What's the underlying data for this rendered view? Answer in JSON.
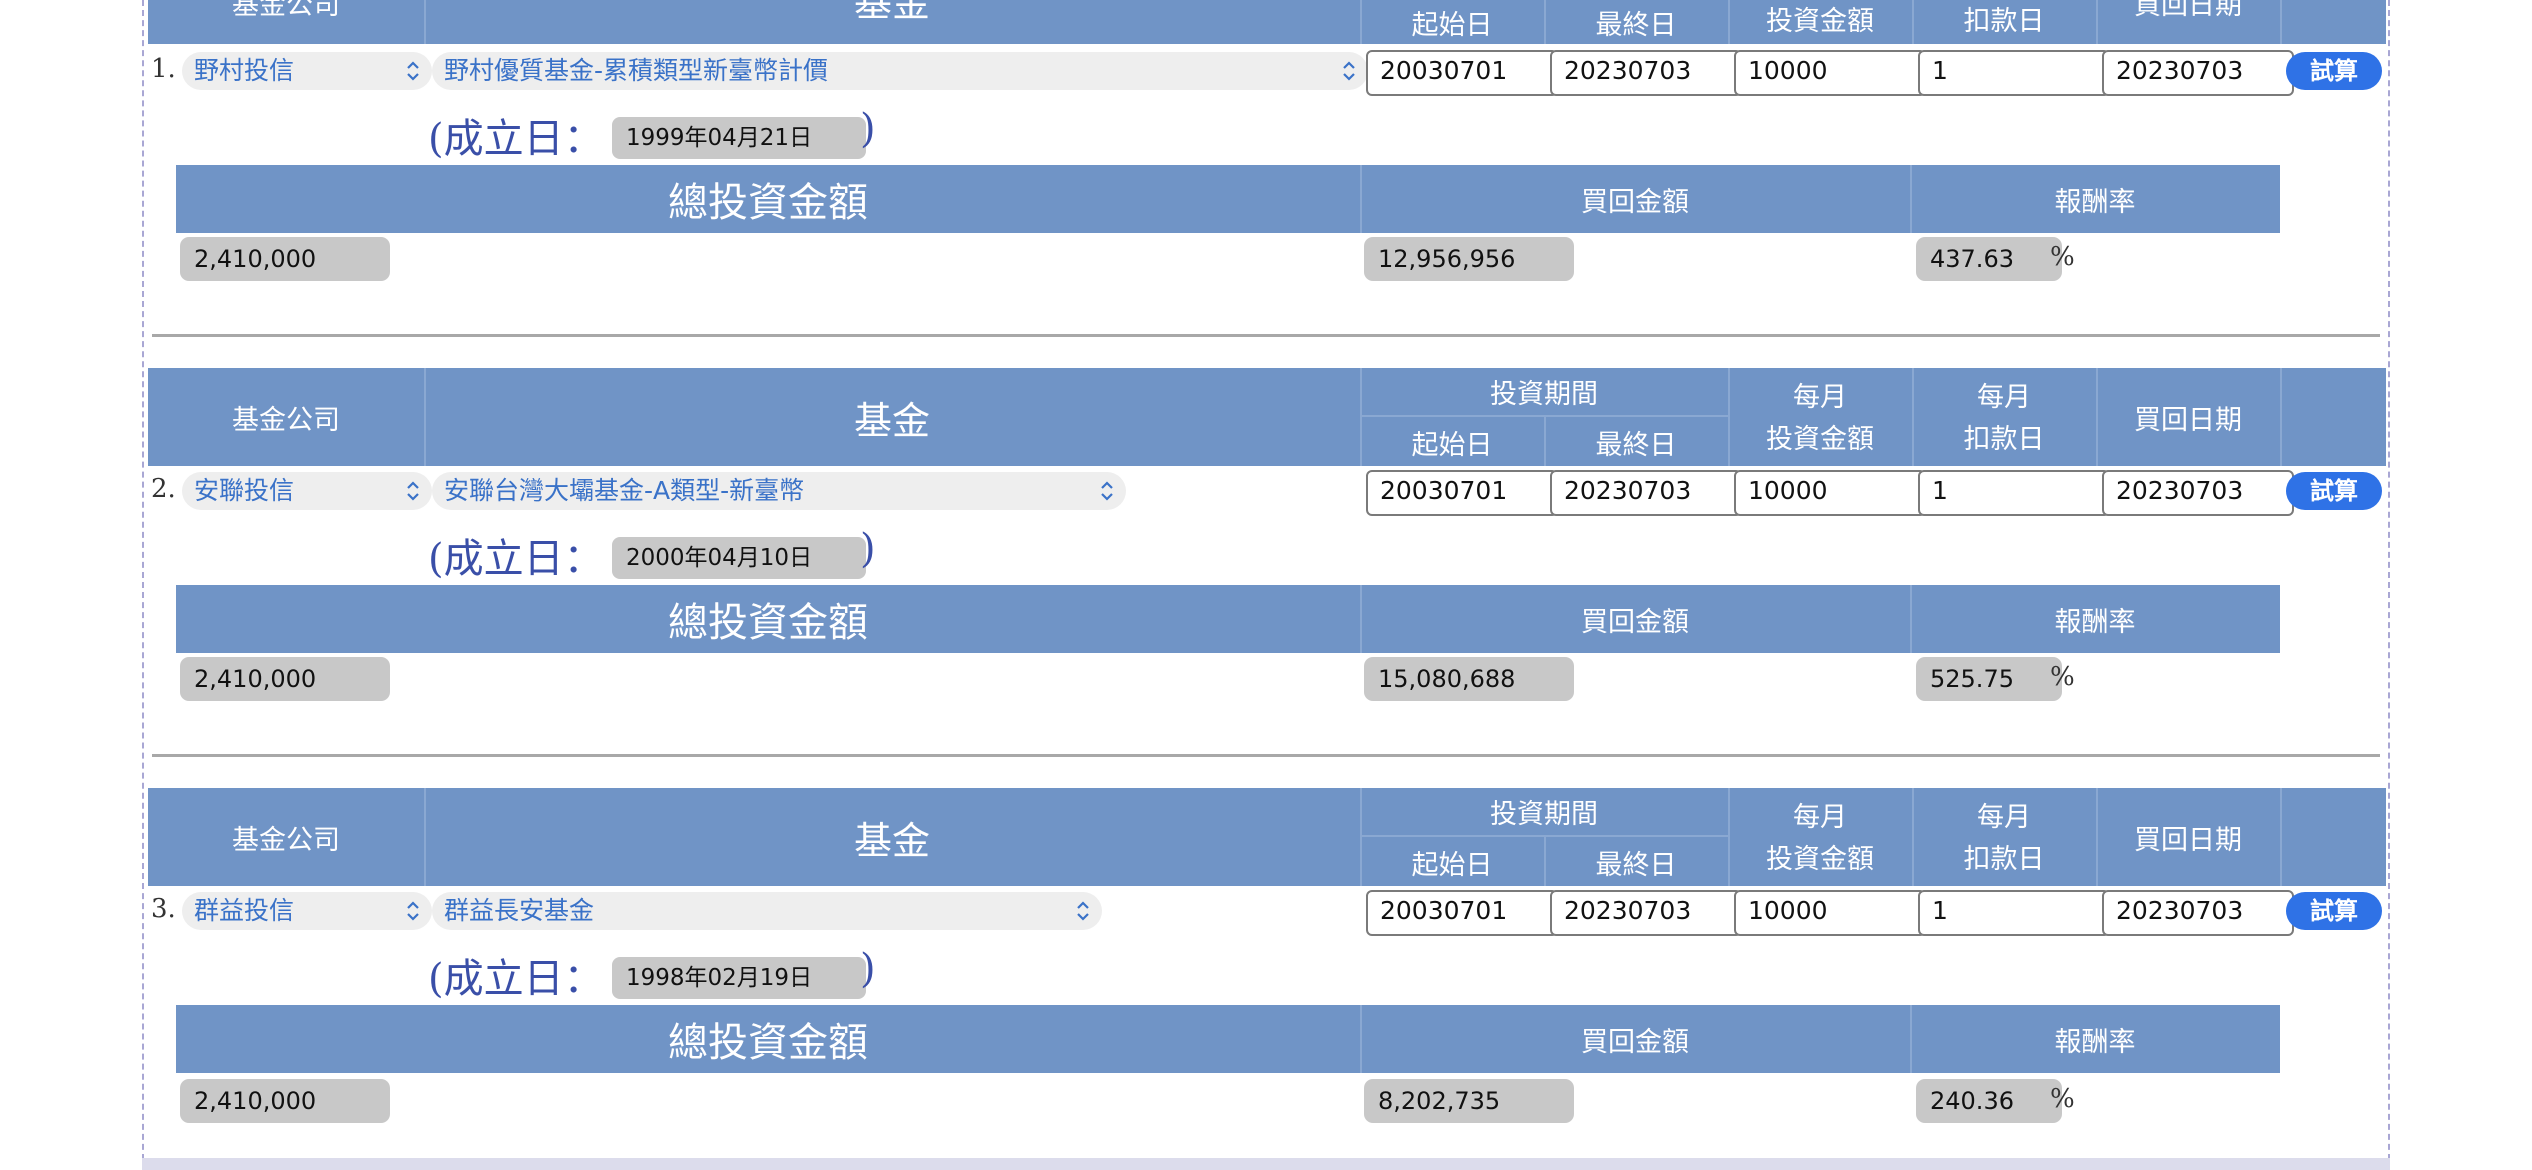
{
  "headers": {
    "company": "基金公司",
    "fund": "基金",
    "period": "投資期間",
    "start": "起始日",
    "end": "最終日",
    "monthly": "每月",
    "amount": "投資金額",
    "debit_day": "扣款日",
    "redeem_date": "買回日期"
  },
  "result_headers": {
    "total": "總投資金額",
    "redeem_amount": "買回金額",
    "return_rate": "報酬率"
  },
  "labels": {
    "established_prefix": "(成立日：",
    "established_suffix": ")",
    "calc_button": "試算",
    "percent": "%"
  },
  "top_partial": {
    "company": "基金公司",
    "fund": "基金",
    "start": "起始日",
    "end": "最終日",
    "amount": "投資金額",
    "debit_day": "扣款日",
    "redeem_date": "買回日期"
  },
  "funds": [
    {
      "num": "1.",
      "company": "野村投信",
      "fund": "野村優質基金-累積類型新臺幣計價",
      "start": "20030701",
      "end": "20230703",
      "amount": "10000",
      "debit_day": "1",
      "redeem_date": "20230703",
      "established": "1999年04月21日",
      "total": "2,410,000",
      "redeem_amount": "12,956,956",
      "return_rate": "437.63"
    },
    {
      "num": "2.",
      "company": "安聯投信",
      "fund": "安聯台灣大壩基金-A類型-新臺幣",
      "start": "20030701",
      "end": "20230703",
      "amount": "10000",
      "debit_day": "1",
      "redeem_date": "20230703",
      "established": "2000年04月10日",
      "total": "2,410,000",
      "redeem_amount": "15,080,688",
      "return_rate": "525.75"
    },
    {
      "num": "3.",
      "company": "群益投信",
      "fund": "群益長安基金",
      "start": "20030701",
      "end": "20230703",
      "amount": "10000",
      "debit_day": "1",
      "redeem_date": "20230703",
      "established": "1998年02月19日",
      "total": "2,410,000",
      "redeem_amount": "8,202,735",
      "return_rate": "240.36"
    }
  ]
}
